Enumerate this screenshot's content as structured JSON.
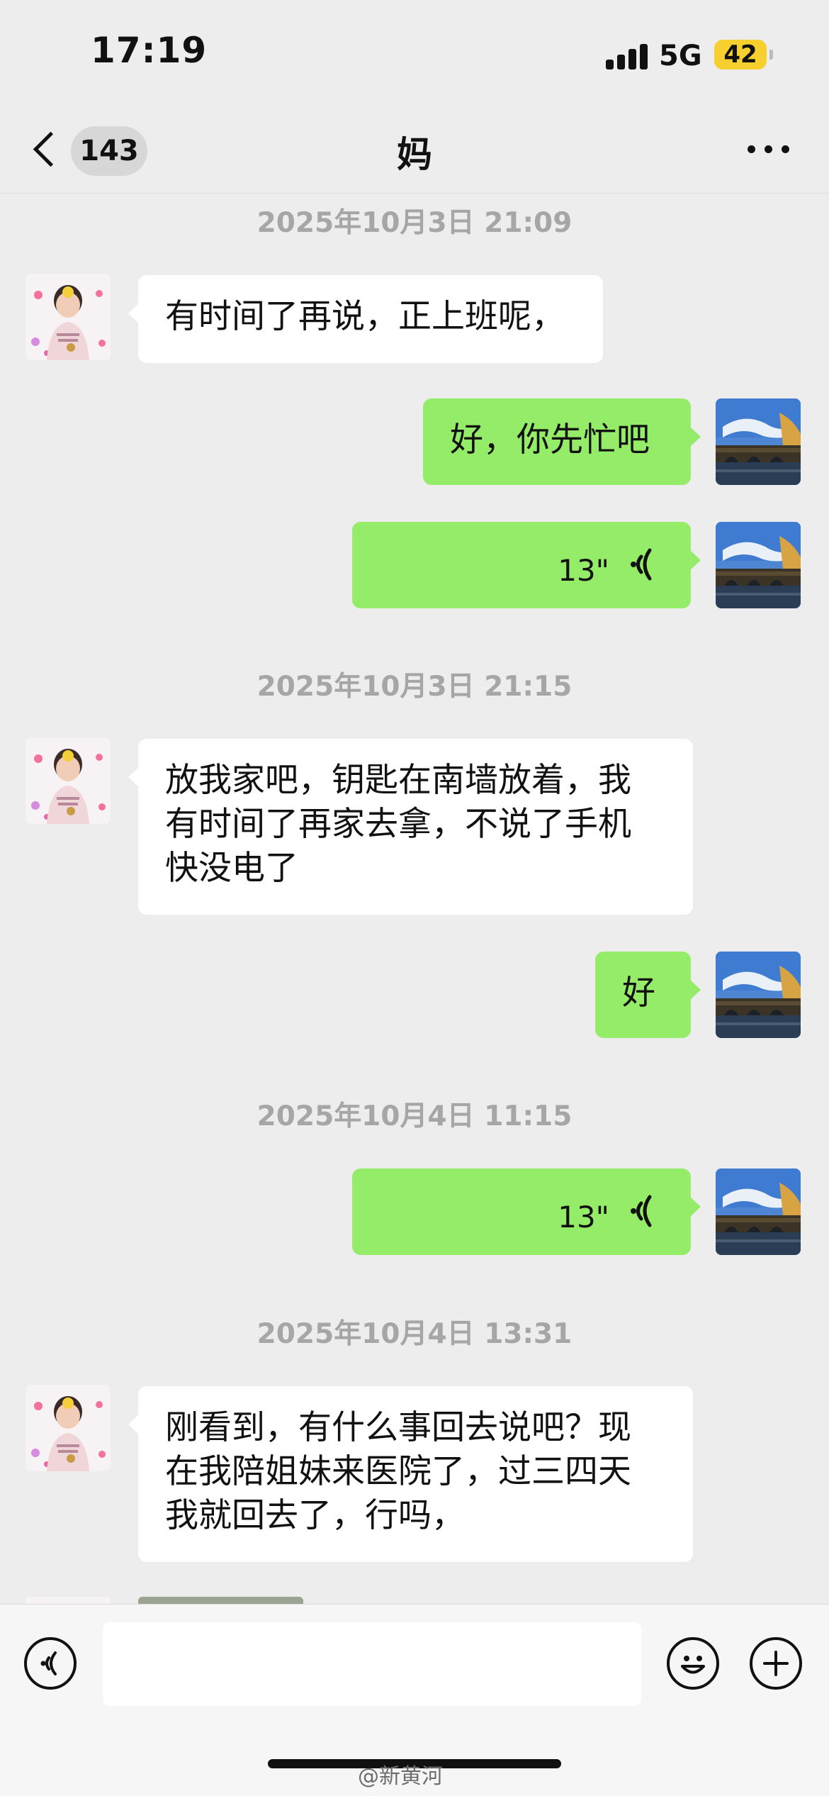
{
  "status_bar": {
    "time": "17:19",
    "network": "5G",
    "battery": "42"
  },
  "header": {
    "back_count": "143",
    "title": "妈",
    "more_icon": "more-dots-icon"
  },
  "messages": [
    {
      "type": "timestamp",
      "text": "2025年10月3日 21:09"
    },
    {
      "type": "text",
      "side": "incoming",
      "text": "有时间了再说，正上班呢，"
    },
    {
      "type": "text",
      "side": "outgoing",
      "text": "好，你先忙吧"
    },
    {
      "type": "voice",
      "side": "outgoing",
      "duration": "13\""
    },
    {
      "type": "timestamp",
      "text": "2025年10月3日 21:15"
    },
    {
      "type": "text",
      "side": "incoming",
      "lines": [
        "放我家吧，钥匙在南墙放着，我",
        "有时间了再家去拿，不说了手机",
        "快没电了"
      ]
    },
    {
      "type": "text",
      "side": "outgoing",
      "text": "好"
    },
    {
      "type": "timestamp",
      "text": "2025年10月4日 11:15"
    },
    {
      "type": "voice",
      "side": "outgoing",
      "duration": "13\""
    },
    {
      "type": "timestamp",
      "text": "2025年10月4日 13:31"
    },
    {
      "type": "text",
      "side": "incoming",
      "lines": [
        "刚看到，有什么事回去说吧？现",
        "在我陪姐妹来医院了，过三四天",
        "我就回去了，行吗，"
      ]
    }
  ],
  "input_bar": {
    "voice_icon": "voice-input-icon",
    "emoji_icon": "emoji-icon",
    "plus_icon": "plus-icon"
  },
  "watermark": "@新黄河",
  "colors": {
    "background": "#ededed",
    "outgoing_bubble": "#95ec69",
    "incoming_bubble": "#ffffff",
    "battery": "#f7cf2e"
  }
}
